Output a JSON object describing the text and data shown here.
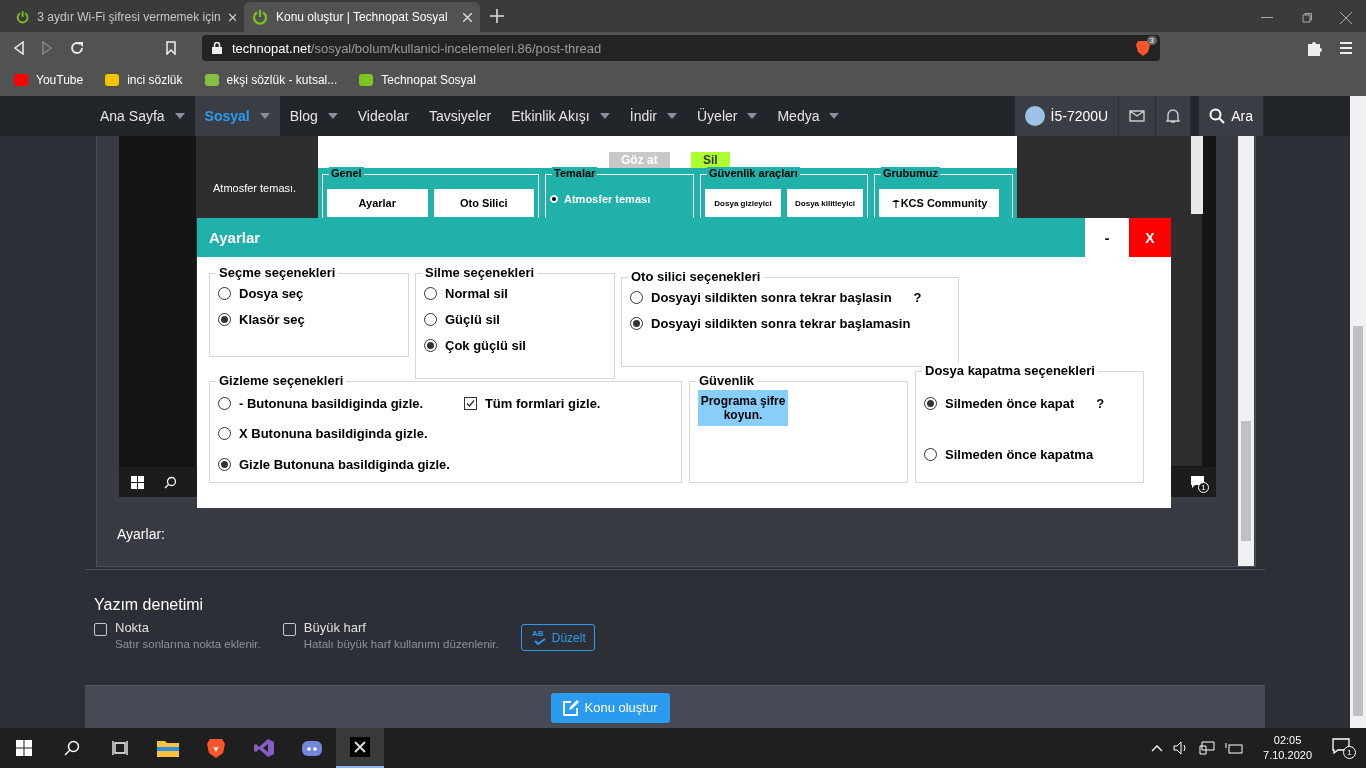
{
  "browser": {
    "tabs": [
      {
        "title": "3 aydır Wi-Fi şifresi vermemek için",
        "selected": false
      },
      {
        "title": "Konu oluştur | Technopat Sosyal",
        "selected": true
      }
    ],
    "url_host": "technopat.net",
    "url_path": "/sosyal/bolum/kullanici-incelemeleri.86/post-thread",
    "shield_count": "3",
    "bookmarks": [
      {
        "label": "YouTube",
        "color": "#ff0000"
      },
      {
        "label": "inci sözlük",
        "color": "#f5c400"
      },
      {
        "label": "ekşi sözlük - kutsal...",
        "color": "#81c341"
      },
      {
        "label": "Technopat Sosyal",
        "color": "#7cc221"
      }
    ]
  },
  "site_nav": {
    "items": [
      {
        "label": "Ana Sayfa",
        "dropdown": true,
        "selected": false
      },
      {
        "label": "Sosyal",
        "dropdown": true,
        "selected": true
      },
      {
        "label": "Blog",
        "dropdown": true,
        "selected": false
      },
      {
        "label": "Videolar",
        "dropdown": false,
        "selected": false
      },
      {
        "label": "Tavsiyeler",
        "dropdown": false,
        "selected": false
      },
      {
        "label": "Etkinlik Akışı",
        "dropdown": true,
        "selected": false
      },
      {
        "label": "İndir",
        "dropdown": true,
        "selected": false
      },
      {
        "label": "Üyeler",
        "dropdown": true,
        "selected": false
      },
      {
        "label": "Medya",
        "dropdown": true,
        "selected": false
      }
    ],
    "user": "İ5-7200U",
    "search": "Ara"
  },
  "embedded_app": {
    "top_buttons": [
      {
        "label": "Göz at",
        "color": "#c8c8c8"
      },
      {
        "label": "Sil",
        "color": "#adff2f"
      }
    ],
    "side_label": "Atmosfer teması.",
    "groups": [
      {
        "title": "Genel",
        "items": [
          {
            "kind": "button",
            "label": "Ayarlar"
          },
          {
            "kind": "button",
            "label": "Oto Silici"
          }
        ]
      },
      {
        "title": "Temalar",
        "items": [
          {
            "kind": "radio",
            "label": "Atmosfer teması",
            "selected": true
          }
        ]
      },
      {
        "title": "Güvenlik araçları",
        "items": [
          {
            "kind": "small-button",
            "label": "Dosya gizleyici"
          },
          {
            "kind": "small-button",
            "label": "Dosya kilitleyici"
          }
        ]
      },
      {
        "title": "Grubumuz",
        "items": [
          {
            "kind": "icon-button",
            "label": "KCS Community"
          }
        ]
      }
    ],
    "taskbar_badge": "1"
  },
  "dialog": {
    "title": "Ayarlar",
    "minimize": "-",
    "close": "X",
    "groups": [
      {
        "title": "Seçme seçenekleri",
        "items": [
          {
            "kind": "radio",
            "label": "Dosya seç",
            "selected": false
          },
          {
            "kind": "radio",
            "label": "Klasör seç",
            "selected": true
          }
        ]
      },
      {
        "title": "Silme seçenekleri",
        "items": [
          {
            "kind": "radio",
            "label": "Normal sil",
            "selected": false
          },
          {
            "kind": "radio",
            "label": "Güçlü sil",
            "selected": false
          },
          {
            "kind": "radio",
            "label": "Çok güçlü sil",
            "selected": true
          }
        ]
      },
      {
        "title": "Oto silici seçenekleri",
        "items": [
          {
            "kind": "radio",
            "label": "Dosyayi sildikten sonra tekrar başlasin",
            "help": "?",
            "selected": false
          },
          {
            "kind": "radio",
            "label": "Dosyayi sildikten sonra tekrar başlamasin",
            "selected": true
          }
        ]
      },
      {
        "title": "Gizleme seçenekleri",
        "items": [
          {
            "kind": "radio",
            "label": "- Butonuna basildiginda gizle.",
            "selected": false
          },
          {
            "kind": "checkbox",
            "label": "Tüm formlari gizle.",
            "checked": true
          },
          {
            "kind": "radio",
            "label": "X Butonuna basildiginda gizle.",
            "selected": false
          },
          {
            "kind": "radio",
            "label": "Gizle Butonuna basildiginda gizle.",
            "selected": true
          }
        ]
      },
      {
        "title": "Güvenlik",
        "items": [
          {
            "kind": "button",
            "label": "Programa şifre koyun."
          }
        ]
      },
      {
        "title": "Dosya kapatma seçenekleri",
        "items": [
          {
            "kind": "radio",
            "label": "Silmeden önce kapat",
            "help": "?",
            "selected": true
          },
          {
            "kind": "radio",
            "label": "Silmeden önce kapatma",
            "selected": false
          }
        ]
      }
    ]
  },
  "editor": {
    "label": "Ayarlar:"
  },
  "spellcheck": {
    "title": "Yazım denetimi",
    "options": [
      {
        "label": "Nokta",
        "hint": "Satır sonlarına nokta eklenir.",
        "checked": false
      },
      {
        "label": "Büyük harf",
        "hint": "Hatalı büyük harf kullanımı düzenlenir.",
        "checked": false
      }
    ],
    "fix_button": "Düzelt",
    "fix_icon_text": "AB"
  },
  "submit": "Konu oluştur",
  "taskbar": {
    "apps": [
      {
        "kind": "explorer",
        "active": false
      },
      {
        "kind": "brave",
        "active": false
      },
      {
        "kind": "vs",
        "active": false
      },
      {
        "kind": "discord",
        "active": false
      },
      {
        "kind": "tool",
        "active": true
      }
    ],
    "time": "02:05",
    "date": "7.10.2020",
    "notification_count": "1"
  }
}
